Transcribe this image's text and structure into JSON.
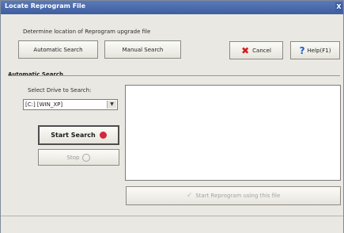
{
  "window": {
    "title": "Locate Reprogram File",
    "close_label": "X"
  },
  "instructions": "Determine location of Reprogram upgrade file",
  "toolbar": {
    "automatic_search_label": "Automatic Search",
    "manual_search_label": "Manual Search",
    "cancel_label": "Cancel",
    "help_label": "Help(F1)"
  },
  "automatic_section": {
    "title": "Automatic Search",
    "drives_label": "Select Drive to Search:",
    "drive_value": "[C:] [WIN_XP]",
    "start_search_label": "Start Search",
    "stop_label": "Stop"
  },
  "results": {
    "items": []
  },
  "reprogram_button_label": "Start Reprogram using this file",
  "icons": {
    "cancel": "x-icon",
    "help": "question-icon",
    "start": "red-dot-icon",
    "stop": "circle-icon",
    "reprogram": "check-icon"
  },
  "colors": {
    "title_bar": "#4a6cae",
    "cancel_icon": "#d21b1b",
    "help_icon": "#1d5fc8",
    "start_icon": "#d6273a"
  }
}
